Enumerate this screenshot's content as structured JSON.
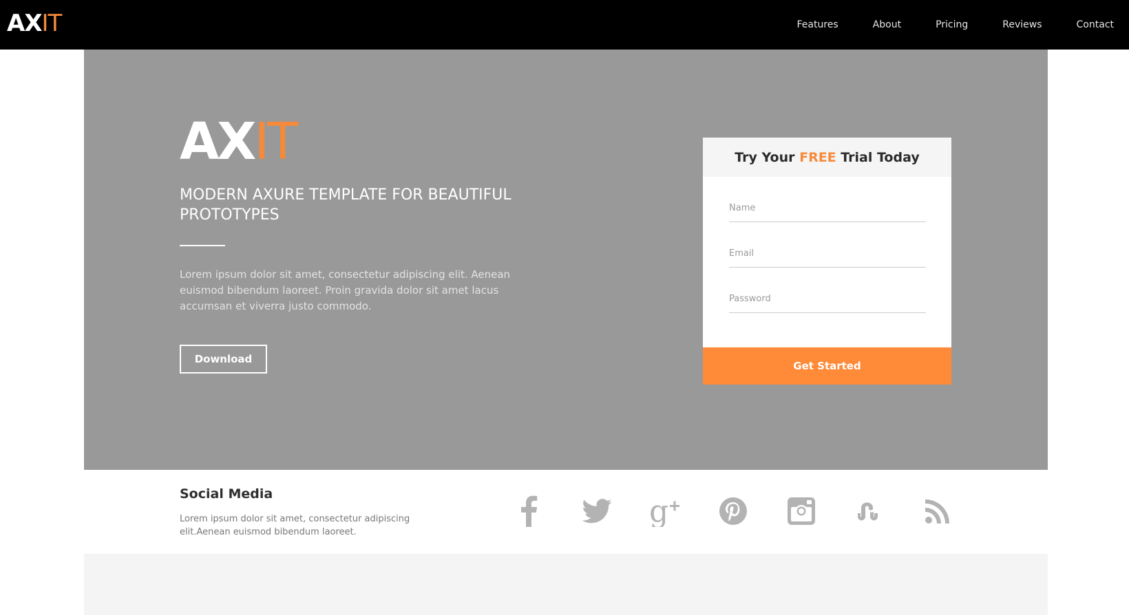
{
  "nav": {
    "logo_bold": "AX",
    "logo_thin": "IT",
    "links": [
      "Features",
      "About",
      "Pricing",
      "Reviews",
      "Contact"
    ]
  },
  "hero": {
    "logo_bold": "AX",
    "logo_thin": "IT",
    "heading": "MODERN AXURE TEMPLATE FOR BEAUTIFUL PROTOTYPES",
    "text": "Lorem ipsum dolor sit amet, consectetur adipiscing elit. Aenean euismod bibendum laoreet. Proin gravida dolor sit amet lacus accumsan et viverra justo commodo.",
    "download_label": "Download"
  },
  "signup": {
    "title_pre": "Try Your ",
    "title_free": "FREE",
    "title_post": " Trial Today",
    "name_placeholder": "Name",
    "email_placeholder": "Email",
    "password_placeholder": "Password",
    "cta_label": "Get Started"
  },
  "social": {
    "title": "Social Media",
    "text": "Lorem ipsum dolor sit amet, consectetur adipiscing elit.Aenean euismod bibendum laoreet.",
    "icons": [
      "facebook-icon",
      "twitter-icon",
      "google-plus-icon",
      "pinterest-icon",
      "instagram-icon",
      "stumbleupon-icon",
      "rss-icon"
    ]
  },
  "colors": {
    "accent": "#f58a3b",
    "nav_bg": "#000000",
    "hero_bg": "#999999",
    "icon_gray": "#b0b0b0"
  }
}
